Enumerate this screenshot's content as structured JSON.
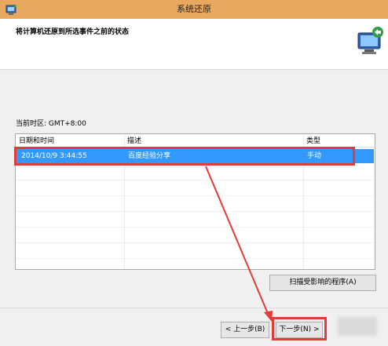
{
  "window": {
    "title": "系统还原"
  },
  "header": {
    "heading": "将计算机还原到所选事件之前的状态"
  },
  "timezone_label": "当前时区: GMT+8:00",
  "table": {
    "columns": [
      "日期和时间",
      "描述",
      "类型"
    ],
    "rows": [
      {
        "datetime": "2014/10/9 3:44:55",
        "description": "百度经验分享",
        "type": "手动"
      }
    ]
  },
  "buttons": {
    "scan": "扫描受影响的程序(A)",
    "back": "< 上一步(B)",
    "next": "下一步(N) >",
    "cancel": ""
  },
  "colors": {
    "highlight": "#e33a3a",
    "selection": "#3399ff"
  },
  "icons": {
    "app": "system-restore-icon",
    "header": "computer-restore-icon"
  }
}
